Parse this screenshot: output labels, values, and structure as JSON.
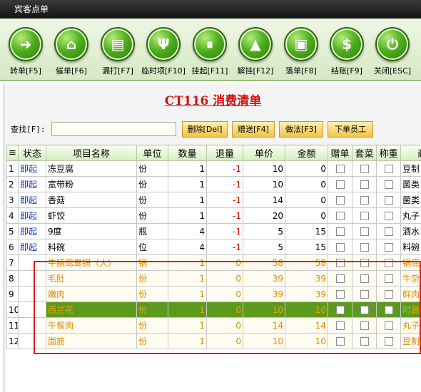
{
  "window": {
    "title": "宾客点单"
  },
  "toolbar": {
    "buttons": [
      {
        "label": "转单[F5]",
        "icon": "forward-arrow-icon",
        "glyph": "➜"
      },
      {
        "label": "催单[F6]",
        "icon": "bank-icon",
        "glyph": "⌂"
      },
      {
        "label": "漏打[F7]",
        "icon": "document-icon",
        "glyph": "▤"
      },
      {
        "label": "临时项[F10]",
        "icon": "cutlery-icon",
        "glyph": "Ψ"
      },
      {
        "label": "挂起[F11]",
        "icon": "hang-icon",
        "glyph": "⏸"
      },
      {
        "label": "解挂[F12]",
        "icon": "unhang-icon",
        "glyph": "▲"
      },
      {
        "label": "落单[F8]",
        "icon": "monitor-icon",
        "glyph": "▣"
      },
      {
        "label": "结账[F9]",
        "icon": "dollar-icon",
        "glyph": "$"
      },
      {
        "label": "关闭[ESC]",
        "icon": "power-icon",
        "glyph": "⏻"
      }
    ]
  },
  "panel": {
    "title": "CT116 消费清单",
    "search_label": "查找[F]:",
    "search_value": "",
    "actions": {
      "delete": "删除[Del]",
      "gift": "赠送[F4]",
      "method": "做法[F3]",
      "staff": "下单员工"
    }
  },
  "grid": {
    "columns": [
      "≡",
      "状态",
      "项目名称",
      "单位",
      "数量",
      "退量",
      "单价",
      "金额",
      "赠单",
      "套菜",
      "称重",
      "商"
    ],
    "rows": [
      {
        "idx": "1",
        "status": "即起",
        "name": "冻豆腐",
        "unit": "份",
        "qty": "1",
        "ret": "-1",
        "price": "10",
        "amount": "0",
        "cat": "豆制"
      },
      {
        "idx": "2",
        "status": "即起",
        "name": "宽带粉",
        "unit": "份",
        "qty": "1",
        "ret": "-1",
        "price": "10",
        "amount": "0",
        "cat": "菌类"
      },
      {
        "idx": "3",
        "status": "即起",
        "name": "香菇",
        "unit": "份",
        "qty": "1",
        "ret": "-1",
        "price": "14",
        "amount": "0",
        "cat": "菌类"
      },
      {
        "idx": "4",
        "status": "即起",
        "name": "虾饺",
        "unit": "份",
        "qty": "1",
        "ret": "-1",
        "price": "20",
        "amount": "0",
        "cat": "丸子"
      },
      {
        "idx": "5",
        "status": "即起",
        "name": "9度",
        "unit": "瓶",
        "qty": "4",
        "ret": "-1",
        "price": "5",
        "amount": "15",
        "cat": "酒水"
      },
      {
        "idx": "6",
        "status": "即起",
        "name": "料碗",
        "unit": "位",
        "qty": "4",
        "ret": "-1",
        "price": "5",
        "amount": "15",
        "cat": "料碗"
      },
      {
        "idx": "7",
        "status": "",
        "name": "牛腩鸳鸯锅（大）",
        "unit": "锅",
        "qty": "1",
        "ret": "0",
        "price": "58",
        "amount": "58",
        "cat": "锅底"
      },
      {
        "idx": "8",
        "status": "",
        "name": "毛肚",
        "unit": "份",
        "qty": "1",
        "ret": "0",
        "price": "39",
        "amount": "39",
        "cat": "牛杂"
      },
      {
        "idx": "9",
        "status": "",
        "name": "嫩肉",
        "unit": "份",
        "qty": "1",
        "ret": "0",
        "price": "39",
        "amount": "39",
        "cat": "鲜肉"
      },
      {
        "idx": "10",
        "status": "",
        "name": "西兰花",
        "unit": "份",
        "qty": "1",
        "ret": "0",
        "price": "10",
        "amount": "10",
        "cat": "时蔬"
      },
      {
        "idx": "11",
        "status": "",
        "name": "午餐肉",
        "unit": "份",
        "qty": "1",
        "ret": "0",
        "price": "14",
        "amount": "14",
        "cat": "丸子"
      },
      {
        "idx": "12",
        "status": "",
        "name": "面筋",
        "unit": "份",
        "qty": "1",
        "ret": "0",
        "price": "10",
        "amount": "10",
        "cat": "豆制"
      }
    ]
  },
  "colors": {
    "accent_green": "#4cae1c",
    "title_red": "#d21010",
    "sent_orange": "#e08a00",
    "selected_row": "#5c9a1e"
  }
}
